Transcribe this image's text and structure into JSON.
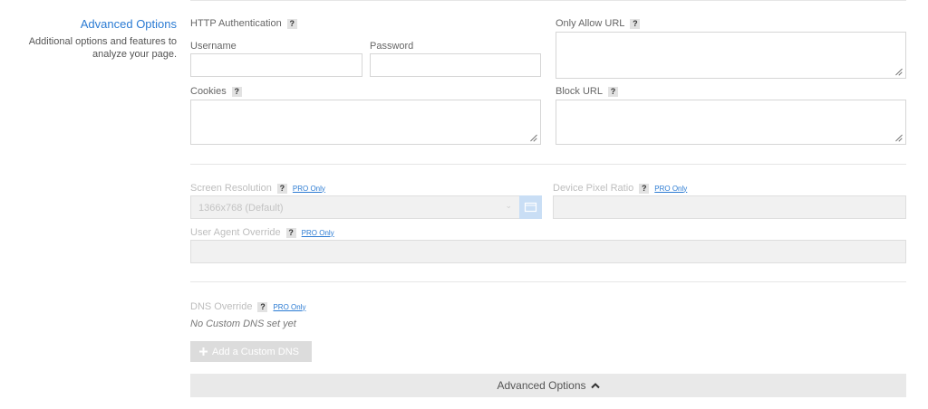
{
  "section": {
    "title": "Advanced Options",
    "description": "Additional options and features to analyze your page."
  },
  "http_auth": {
    "label": "HTTP Authentication",
    "username_label": "Username",
    "password_label": "Password"
  },
  "only_allow_url": {
    "label": "Only Allow URL"
  },
  "cookies": {
    "label": "Cookies"
  },
  "block_url": {
    "label": "Block URL"
  },
  "help_glyph": "?",
  "pro_only": "PRO Only",
  "screen_resolution": {
    "label": "Screen Resolution",
    "selected": "1366x768 (Default)"
  },
  "device_pixel_ratio": {
    "label": "Device Pixel Ratio"
  },
  "user_agent_override": {
    "label": "User Agent Override"
  },
  "dns_override": {
    "label": "DNS Override",
    "empty_note": "No Custom DNS set yet",
    "add_button": "Add a Custom DNS"
  },
  "advanced_toggle": {
    "label": "Advanced Options"
  },
  "colors": {
    "accent": "#2b7bd3",
    "disabled_text": "#bdbdbd"
  }
}
